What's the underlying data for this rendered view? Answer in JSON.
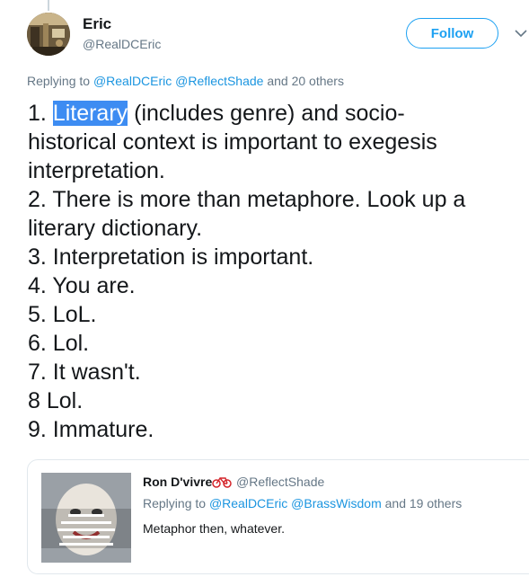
{
  "tweet": {
    "author_name": "Eric",
    "author_handle": "@RealDCEric",
    "follow_label": "Follow",
    "replying_prefix": "Replying to",
    "replying_user1": "@RealDCEric",
    "replying_user2": "@ReflectShade",
    "replying_suffix": "and 20 others",
    "highlighted_word": "Literary",
    "lines": [
      "1. ",
      " (includes genre) and socio-",
      "historical context is important to exegesis",
      "interpretation.",
      "2. There is more than metaphore. Look up a",
      "literary dictionary.",
      "3. Interpretation is important.",
      "4. You are.",
      "5. LoL.",
      "6. Lol.",
      "7. It wasn't.",
      "8 Lol.",
      "9. Immature."
    ]
  },
  "quoted": {
    "author_name": "Ron D'vivre",
    "author_handle": "@ReflectShade",
    "replying_prefix": "Replying to",
    "replying_user1": "@RealDCEric",
    "replying_user2": "@BrassWisdom",
    "replying_suffix": "and 19 others",
    "text": "Metaphor then, whatever."
  },
  "colors": {
    "accent": "#1da1f2",
    "link": "#1b95e0",
    "secondary_text": "#657786",
    "highlight": "#3d8cf2"
  },
  "icons": {
    "caret": "chevron-down-icon",
    "bike": "bicycle-emoji-icon"
  }
}
